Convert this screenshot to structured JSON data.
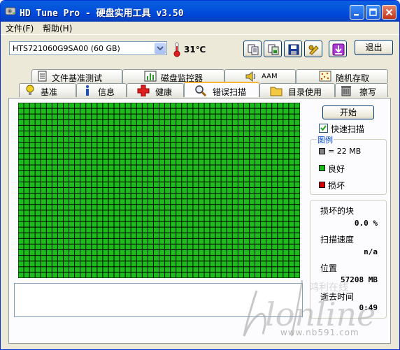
{
  "window": {
    "title": "HD Tune Pro - 硬盘实用工具 v3.50"
  },
  "menu": {
    "file": "文件(F)",
    "help": "帮助(H)"
  },
  "toolbar": {
    "drive": "HTS721060G9SA00 (60 GB)",
    "temperature": "31℃",
    "exit_label": "退出",
    "buttons": [
      "copy-text-icon",
      "copy-image-icon",
      "save-icon",
      "options-icon",
      "download-icon"
    ]
  },
  "tabs_top": [
    "文件基准测试",
    "磁盘监控器",
    "AAM",
    "随机存取"
  ],
  "tabs_bottom": [
    "基准",
    "信息",
    "健康",
    "错误扫描",
    "目录使用",
    "擦写"
  ],
  "active_tab": "错误扫描",
  "error_scan": {
    "start_label": "开始",
    "quick_scan_label": "快速扫描",
    "quick_scan_checked": true,
    "legend": {
      "title": "图例",
      "block_size": "= 22 MB",
      "good": "良好",
      "bad": "损坏"
    },
    "stats": {
      "damaged_label": "损坏的块",
      "damaged_value": "0.0 %",
      "speed_label": "扫描速度",
      "speed_value": "n/a",
      "position_label": "位置",
      "position_value": "57208 MB",
      "elapsed_label": "逝去时间",
      "elapsed_value": "0:49"
    },
    "block_grid": {
      "columns": 50,
      "rows": 31,
      "status": "good"
    }
  },
  "colors": {
    "good": "#1cbc1c",
    "bad": "#d40000",
    "block_legend": "#808080"
  },
  "watermark": {
    "brand": "Hlonline",
    "cn": "鸿利在线",
    "url": "www.nb591.com"
  }
}
